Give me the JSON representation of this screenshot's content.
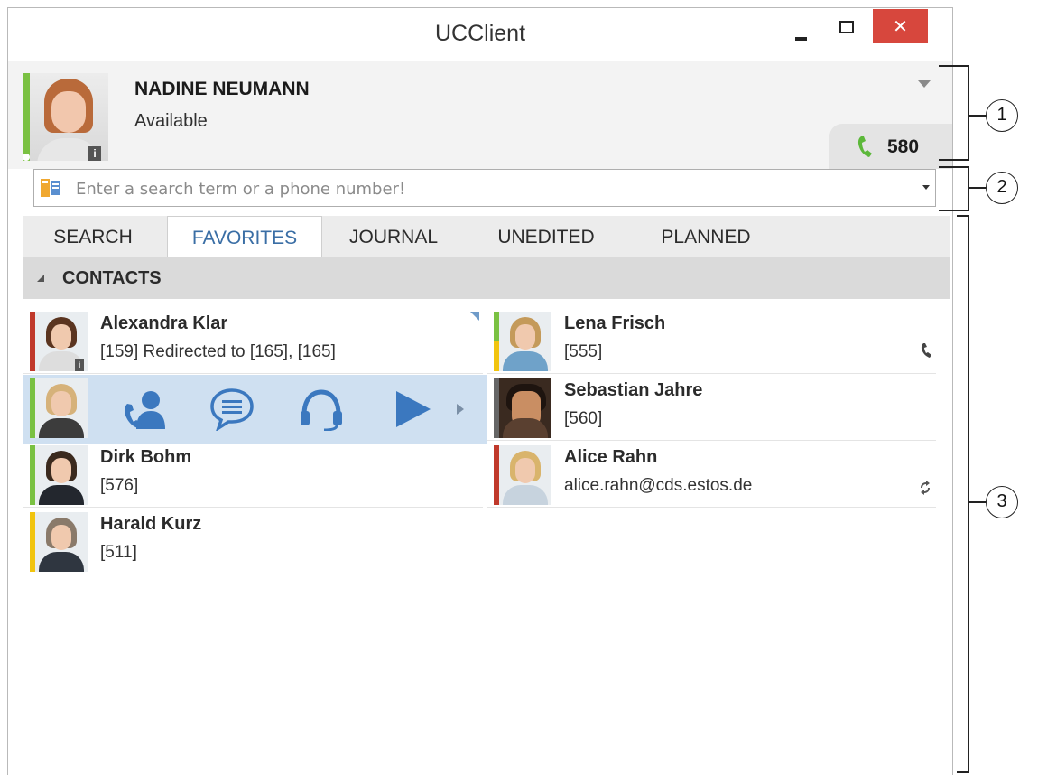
{
  "window": {
    "title": "UCClient",
    "close_glyph": "✕"
  },
  "profile": {
    "name": "NADINE NEUMANN",
    "status": "Available",
    "info_badge": "i",
    "line_number": "580",
    "status_color": "#7ac142"
  },
  "search": {
    "placeholder": "Enter a search term or a phone number!"
  },
  "tabs": [
    "SEARCH",
    "FAVORITES",
    "JOURNAL",
    "UNEDITED",
    "PLANNED"
  ],
  "active_tab": "FAVORITES",
  "section": {
    "title": "CONTACTS"
  },
  "contacts": [
    {
      "name": "Alexandra Klar",
      "detail": "[159] Redirected to  [165], [165]",
      "status_color": "#c0392b"
    },
    {
      "name": "Lena Frisch",
      "detail": "[555]",
      "status_color": "#7ac142"
    },
    {
      "name": "Sebastian Jahre",
      "detail": "[560]",
      "status_color": "#666666"
    },
    {
      "name": "Dirk Bohm",
      "detail": "[576]",
      "status_color": "#7ac142"
    },
    {
      "name": "Alice Rahn",
      "detail": "alice.rahn@cds.estos.de",
      "status_color": "#c0392b"
    },
    {
      "name": "Harald Kurz",
      "detail": "[511]",
      "status_color": "#f1c40f"
    }
  ],
  "quick_actions": [
    "contact-call-icon",
    "chat-bubble-icon",
    "headset-icon",
    "play-icon",
    "more-arrow-icon"
  ],
  "callouts": [
    "1",
    "2",
    "3"
  ]
}
